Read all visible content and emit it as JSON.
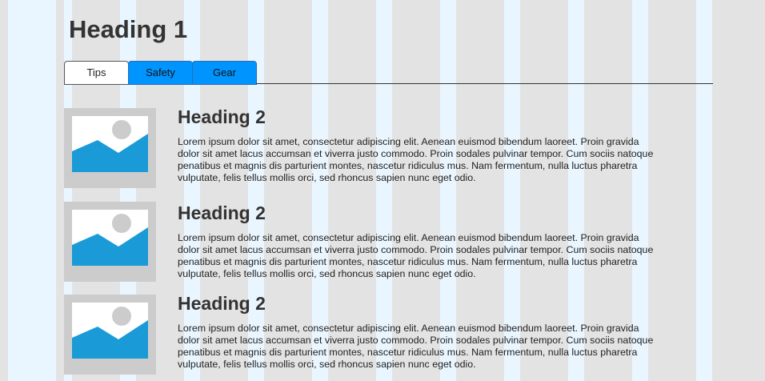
{
  "page": {
    "title": "Heading 1"
  },
  "tabs": [
    {
      "label": "Tips",
      "active": true
    },
    {
      "label": "Safety",
      "active": false
    },
    {
      "label": "Gear",
      "active": false
    }
  ],
  "articles": [
    {
      "heading": "Heading 2",
      "body": "Lorem ipsum dolor sit amet, consectetur adipiscing elit. Aenean euismod bibendum laoreet. Proin gravida dolor sit amet lacus accumsan et viverra justo commodo. Proin sodales pulvinar tempor. Cum sociis natoque penatibus et magnis dis parturient montes, nascetur ridiculus mus. Nam fermentum, nulla luctus pharetra vulputate, felis tellus mollis orci, sed rhoncus sapien nunc eget odio.",
      "image_icon": "image-placeholder-icon"
    },
    {
      "heading": "Heading 2",
      "body": "Lorem ipsum dolor sit amet, consectetur adipiscing elit. Aenean euismod bibendum laoreet. Proin gravida dolor sit amet lacus accumsan et viverra justo commodo. Proin sodales pulvinar tempor. Cum sociis natoque penatibus et magnis dis parturient montes, nascetur ridiculus mus. Nam fermentum, nulla luctus pharetra vulputate, felis tellus mollis orci, sed rhoncus sapien nunc eget odio.",
      "image_icon": "image-placeholder-icon"
    },
    {
      "heading": "Heading 2",
      "body": "Lorem ipsum dolor sit amet, consectetur adipiscing elit. Aenean euismod bibendum laoreet. Proin gravida dolor sit amet lacus accumsan et viverra justo commodo. Proin sodales pulvinar tempor. Cum sociis natoque penatibus et magnis dis parturient montes, nascetur ridiculus mus. Nam fermentum, nulla luctus pharetra vulputate, felis tellus mollis orci, sed rhoncus sapien nunc eget odio.",
      "image_icon": "image-placeholder-icon"
    }
  ],
  "colors": {
    "tab_active_bg": "#ffffff",
    "tab_inactive_bg": "#0094ff",
    "image_accent": "#1a9bd7",
    "image_frame": "#cccccc"
  }
}
